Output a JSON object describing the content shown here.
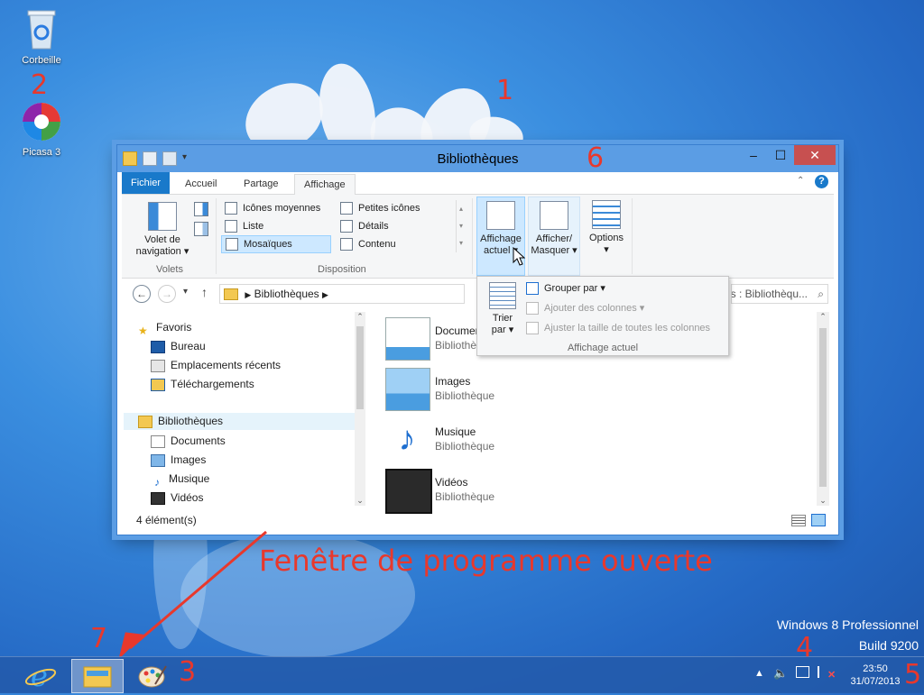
{
  "desktop": {
    "icons": [
      {
        "label": "Corbeille",
        "icon": "recycle-bin-icon"
      },
      {
        "label": "Picasa 3",
        "icon": "picasa-icon"
      }
    ],
    "watermark_line1": "Windows 8 Professionnel",
    "watermark_line2": "Build 9200"
  },
  "annotations": {
    "n1": "1",
    "n2": "2",
    "n3": "3",
    "n4": "4",
    "n5": "5",
    "n6": "6",
    "n7": "7",
    "caption": "Fenêtre de programme ouverte",
    "color": "#e8382c"
  },
  "window": {
    "title": "Bibliothèques",
    "tabs": [
      "Fichier",
      "Accueil",
      "Partage",
      "Affichage"
    ],
    "active_tab": "Affichage",
    "ribbon": {
      "panes": {
        "button_line1": "Volet de",
        "button_line2": "navigation",
        "group": "Volets"
      },
      "layout": {
        "items": [
          "Icônes moyennes",
          "Petites icônes",
          "Liste",
          "Détails",
          "Mosaïques",
          "Contenu"
        ],
        "selected": "Mosaïques",
        "group": "Disposition"
      },
      "current_view": {
        "line1": "Affichage",
        "line2": "actuel"
      },
      "show_hide": {
        "line1": "Afficher/",
        "line2": "Masquer"
      },
      "options": "Options"
    },
    "dropdown": {
      "sort_line1": "Trier",
      "sort_line2": "par",
      "group_by": "Grouper par",
      "add_columns": "Ajouter des colonnes",
      "fit_columns": "Ajuster la taille de toutes les colonnes",
      "group_label": "Affichage actuel"
    },
    "address": {
      "path": "Bibliothèques",
      "search_placeholder": "Rechercher dans : Bibliothèqu..."
    },
    "nav": {
      "favorites": "Favoris",
      "favorite_items": [
        "Bureau",
        "Emplacements récents",
        "Téléchargements"
      ],
      "libraries": "Bibliothèques",
      "library_items": [
        "Documents",
        "Images",
        "Musique",
        "Vidéos"
      ]
    },
    "items": [
      {
        "name": "Documents",
        "type": "Bibliothèque",
        "icon": "documents-library-icon"
      },
      {
        "name": "Images",
        "type": "Bibliothèque",
        "icon": "images-library-icon"
      },
      {
        "name": "Musique",
        "type": "Bibliothèque",
        "icon": "music-library-icon"
      },
      {
        "name": "Vidéos",
        "type": "Bibliothèque",
        "icon": "videos-library-icon"
      }
    ],
    "status": "4 élément(s)"
  },
  "taskbar": {
    "time": "23:50",
    "date": "31/07/2013"
  }
}
